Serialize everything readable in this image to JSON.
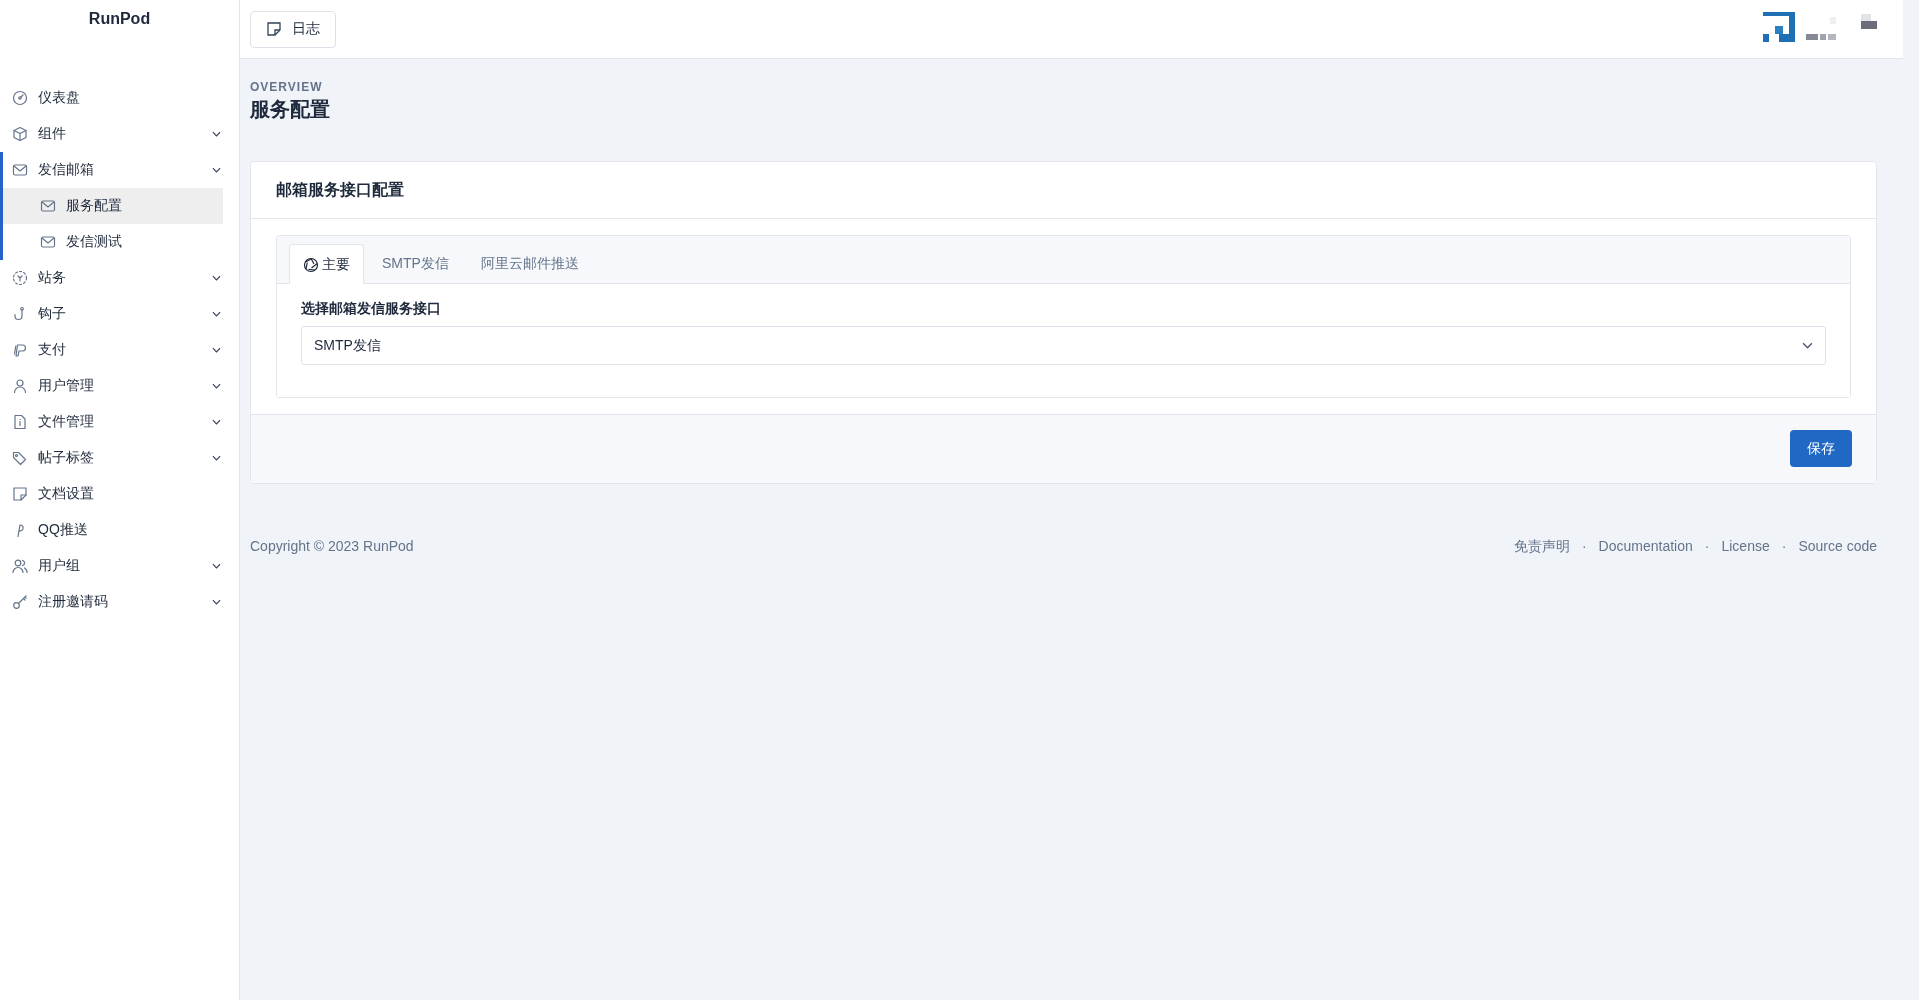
{
  "sidebar": {
    "brand": "RunPod",
    "items": [
      {
        "label": "仪表盘",
        "expandable": false,
        "expanded": false
      },
      {
        "label": "组件",
        "expandable": true,
        "expanded": false
      },
      {
        "label": "发信邮箱",
        "expandable": true,
        "expanded": true,
        "children": [
          {
            "label": "服务配置",
            "selected": true
          },
          {
            "label": "发信测试",
            "selected": false
          }
        ]
      },
      {
        "label": "站务",
        "expandable": true,
        "expanded": false
      },
      {
        "label": "钩子",
        "expandable": true,
        "expanded": false
      },
      {
        "label": "支付",
        "expandable": true,
        "expanded": false
      },
      {
        "label": "用户管理",
        "expandable": true,
        "expanded": false
      },
      {
        "label": "文件管理",
        "expandable": true,
        "expanded": false
      },
      {
        "label": "帖子标签",
        "expandable": true,
        "expanded": false
      },
      {
        "label": "文档设置",
        "expandable": false,
        "expanded": false
      },
      {
        "label": "QQ推送",
        "expandable": false,
        "expanded": false
      },
      {
        "label": "用户组",
        "expandable": true,
        "expanded": false
      },
      {
        "label": "注册邀请码",
        "expandable": true,
        "expanded": false
      }
    ]
  },
  "topbar": {
    "log_button": "日志"
  },
  "page": {
    "eyebrow": "OVERVIEW",
    "title": "服务配置"
  },
  "card": {
    "title": "邮箱服务接口配置",
    "tabs": [
      {
        "label": "主要",
        "selected": true
      },
      {
        "label": "SMTP发信",
        "selected": false
      },
      {
        "label": "阿里云邮件推送",
        "selected": false
      }
    ],
    "field_label": "选择邮箱发信服务接口",
    "select_value": "SMTP发信",
    "save_button": "保存"
  },
  "footer": {
    "copyright": "Copyright © 2023 RunPod",
    "separator": "·",
    "links": [
      "免责声明",
      "Documentation",
      "License",
      "Source code"
    ]
  }
}
